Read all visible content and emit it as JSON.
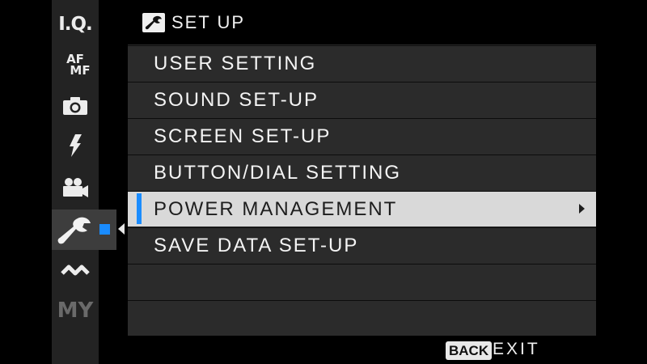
{
  "sidebar": {
    "tabs": [
      {
        "id": "iq",
        "label": "I.Q."
      },
      {
        "id": "afmf",
        "label_top": "AF",
        "label_bottom": "MF"
      },
      {
        "id": "shooting",
        "icon": "camera-icon"
      },
      {
        "id": "flash",
        "icon": "flash-icon"
      },
      {
        "id": "movie",
        "icon": "movie-camera-icon"
      },
      {
        "id": "setup",
        "icon": "wrench-icon",
        "active": true
      },
      {
        "id": "connection",
        "icon": "wireless-icon"
      },
      {
        "id": "my",
        "label": "MY"
      }
    ]
  },
  "header": {
    "icon": "wrench-icon",
    "title": "SET UP"
  },
  "menu": {
    "items": [
      {
        "label": "USER SETTING"
      },
      {
        "label": "SOUND SET-UP"
      },
      {
        "label": "SCREEN SET-UP"
      },
      {
        "label": "BUTTON/DIAL SETTING"
      },
      {
        "label": "POWER MANAGEMENT",
        "selected": true,
        "has_submenu": true
      },
      {
        "label": "SAVE DATA SET-UP"
      },
      {
        "label": ""
      },
      {
        "label": ""
      }
    ]
  },
  "footer": {
    "back_key": "BACK",
    "exit_label": "EXIT"
  },
  "colors": {
    "accent": "#1a8cff",
    "selected_row": "#d9d9d9",
    "row_bg": "#2b2b2b",
    "sidebar_bg": "#232323"
  }
}
